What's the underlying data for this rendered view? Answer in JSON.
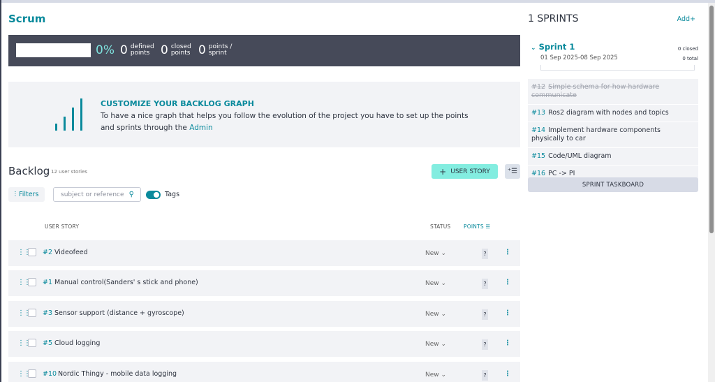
{
  "project": {
    "title": "Scrum"
  },
  "summary": {
    "percent": "0%",
    "progress_fraction": 0,
    "defined": {
      "value": "0",
      "label_line1": "defined",
      "label_line2": "points"
    },
    "closed": {
      "value": "0",
      "label_line1": "closed",
      "label_line2": "points"
    },
    "per_sprint": {
      "value": "0",
      "label_line1": "points /",
      "label_line2": "sprint"
    }
  },
  "graph_promo": {
    "title": "CUSTOMIZE YOUR BACKLOG GRAPH",
    "text": "To have a nice graph that helps you follow the evolution of the project you have to set up the points and sprints through the ",
    "link": "Admin"
  },
  "backlog": {
    "title": "Backlog",
    "count": "12 user stories",
    "add_button": "USER STORY",
    "filters_label": "Filters",
    "search_placeholder": "subject or reference",
    "tags_label": "Tags",
    "columns": {
      "user_story": "USER STORY",
      "status": "STATUS",
      "points": "POINTS"
    },
    "rows": [
      {
        "ref": "#2",
        "subject": "Videofeed",
        "status": "New",
        "points": "?"
      },
      {
        "ref": "#1",
        "subject": "Manual control(Sanders' s stick and phone)",
        "status": "New",
        "points": "?"
      },
      {
        "ref": "#3",
        "subject": "Sensor support (distance + gyroscope)",
        "status": "New",
        "points": "?"
      },
      {
        "ref": "#5",
        "subject": "Cloud logging",
        "status": "New",
        "points": "?"
      },
      {
        "ref": "#10",
        "subject": "Nordic Thingy - mobile data logging",
        "status": "New",
        "points": "?"
      }
    ]
  },
  "sidebar": {
    "title": "1 SPRINTS",
    "add_label": "Add",
    "sprint": {
      "name": "Sprint 1",
      "dates": "01 Sep 2025-08 Sep 2025",
      "closed": "0 closed",
      "total": "0 total"
    },
    "items": [
      {
        "ref": "#12",
        "subject": "Simple schema for how hardware communicate",
        "done": true
      },
      {
        "ref": "#13",
        "subject": "Ros2 diagram with nodes and topics",
        "done": false
      },
      {
        "ref": "#14",
        "subject": "Implement hardware components physically to car",
        "done": false
      },
      {
        "ref": "#15",
        "subject": "Code/UML diagram",
        "done": false
      },
      {
        "ref": "#16",
        "subject": "PC -> PI",
        "done": false
      }
    ],
    "taskboard_label": "SPRINT TASKBOARD"
  },
  "colors": {
    "accent": "#0a8a9c",
    "summary_bg": "#464a59",
    "button_bg": "#83ede0"
  }
}
